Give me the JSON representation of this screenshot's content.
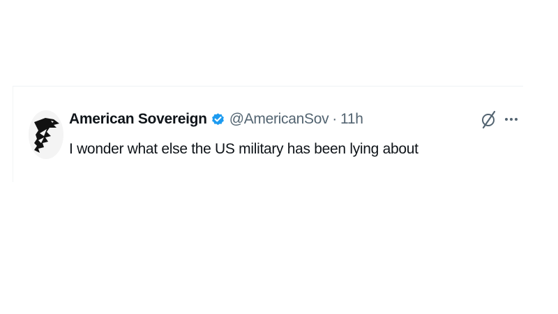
{
  "tweet": {
    "display_name": "American Sovereign",
    "handle": "@AmericanSov",
    "separator": "·",
    "timestamp": "11h",
    "text": "I wonder what else the US military has been lying about",
    "verified": true
  },
  "icons": {
    "avatar": "eagle-logo",
    "verified": "verified-badge-icon",
    "grok": "grok-icon",
    "more": "more-options-icon"
  },
  "colors": {
    "verified_blue": "#1d9bf0",
    "text_primary": "#0f1419",
    "text_secondary": "#536471"
  }
}
